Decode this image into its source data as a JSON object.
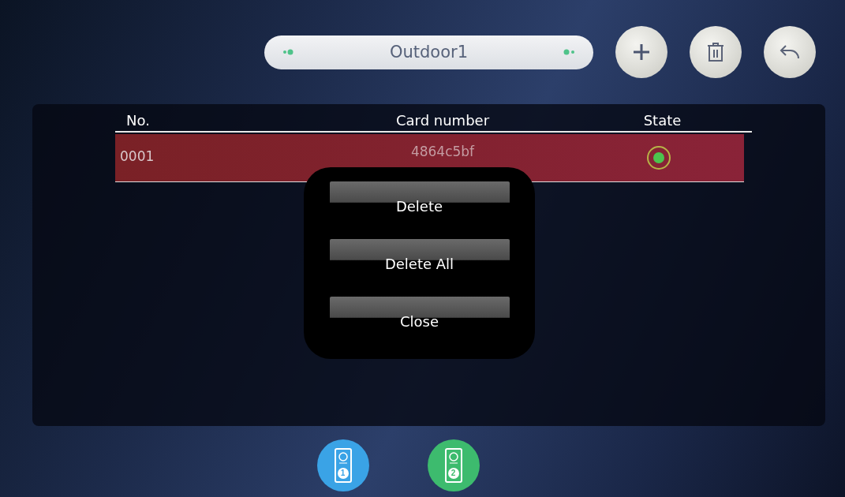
{
  "header": {
    "title": "Outdoor1"
  },
  "table": {
    "columns": [
      "No.",
      "Card number",
      "State"
    ],
    "rows": [
      {
        "no": "0001",
        "card_number": "4864c5bf",
        "state_on": true,
        "selected": true
      }
    ]
  },
  "menu": {
    "buttons": [
      "Delete",
      "Delete All",
      "Close"
    ]
  },
  "devices": [
    {
      "number": "1",
      "color": "#3aa3e6",
      "selected": false
    },
    {
      "number": "2",
      "color": "#3dbb6e",
      "selected": false
    }
  ]
}
